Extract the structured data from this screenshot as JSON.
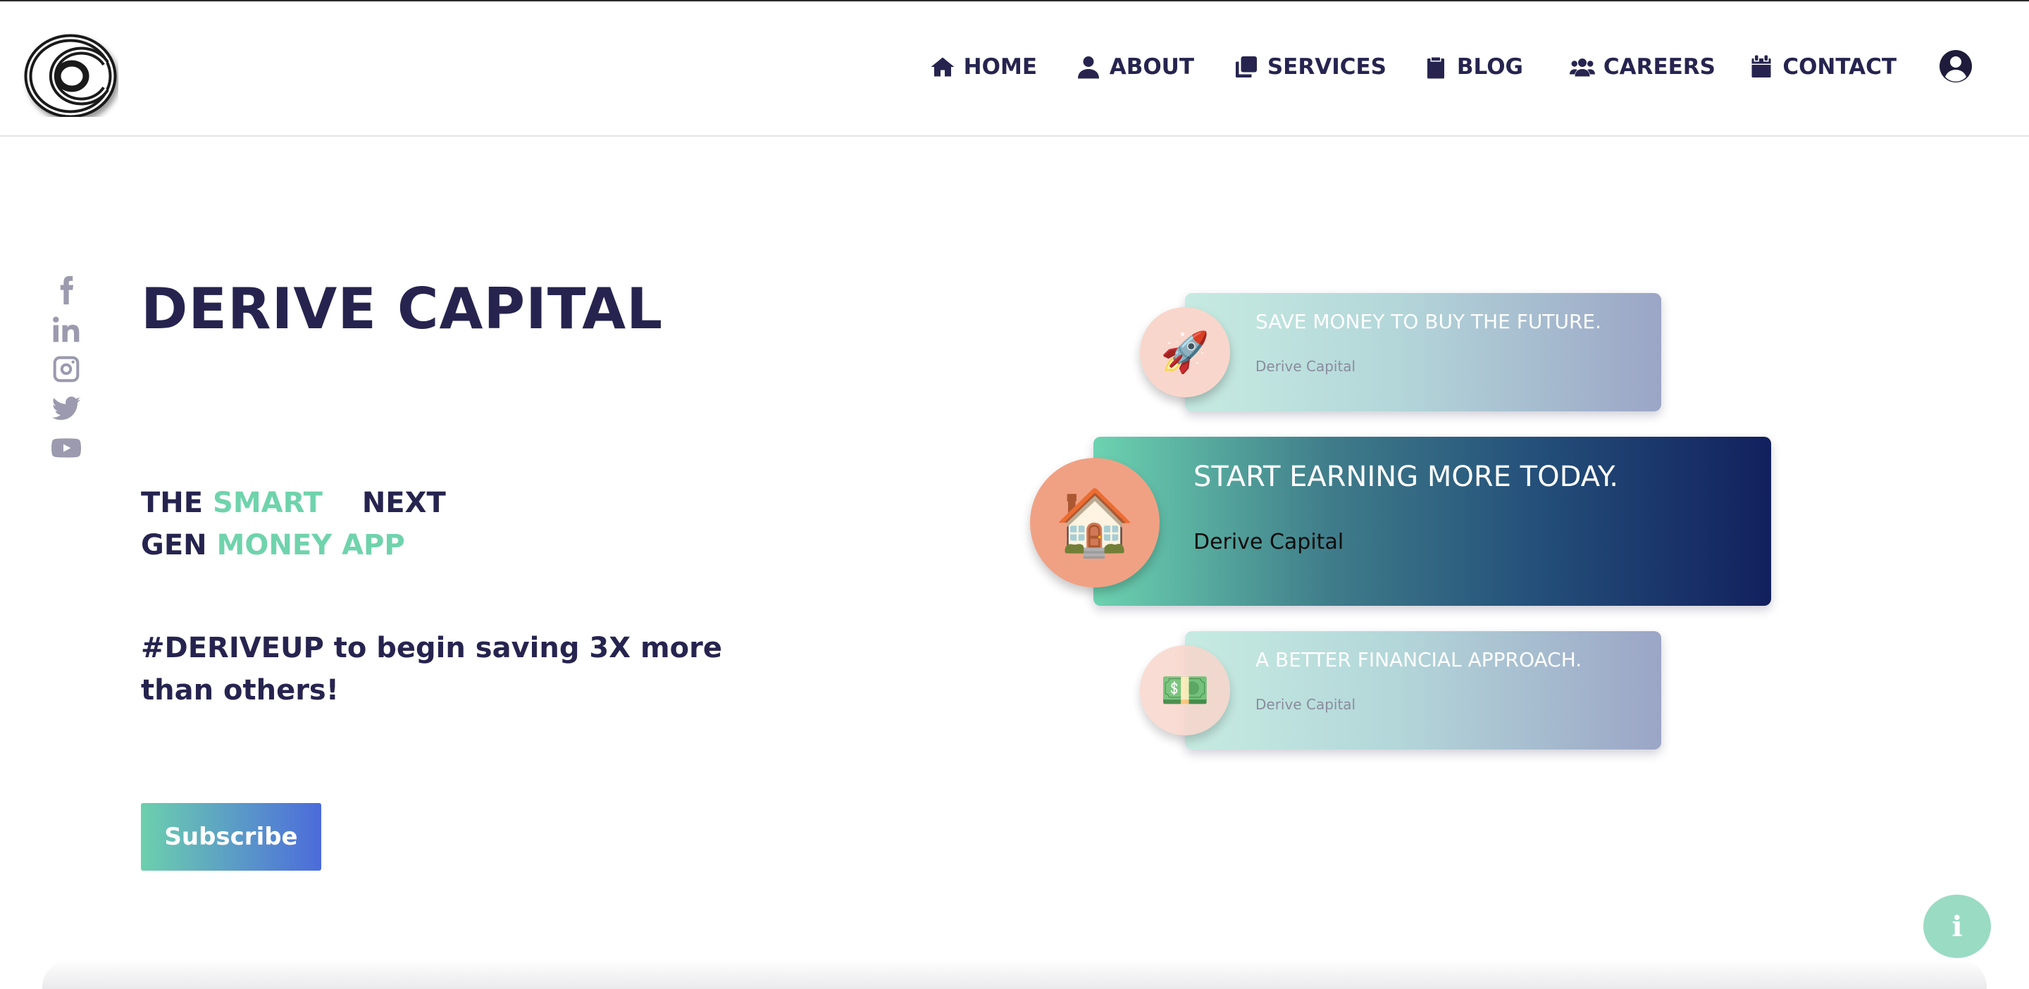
{
  "nav": {
    "items": [
      {
        "label": "HOME",
        "icon": "home-icon"
      },
      {
        "label": "ABOUT",
        "icon": "user-icon"
      },
      {
        "label": "SERVICES",
        "icon": "clone-icon"
      },
      {
        "label": "BLOG",
        "icon": "clipboard-icon"
      },
      {
        "label": "CAREERS",
        "icon": "users-icon"
      },
      {
        "label": "CONTACT",
        "icon": "calendar-icon"
      }
    ]
  },
  "social": [
    "facebook-icon",
    "linkedin-icon",
    "instagram-icon",
    "twitter-icon",
    "youtube-icon"
  ],
  "hero": {
    "title": "DERIVE CAPITAL",
    "tagline": {
      "w1": "THE",
      "w2": "SMART",
      "w3": "NEXT",
      "w4": "GEN",
      "w5": "MONEY APP"
    },
    "promo": "#DERIVEUP to begin saving 3X more than others!",
    "subscribe_label": "Subscribe"
  },
  "cards": [
    {
      "title": "SAVE MONEY TO BUY THE FUTURE.",
      "subtitle": "Derive Capital",
      "emoji": "🚀"
    },
    {
      "title": "START EARNING MORE TODAY.",
      "subtitle": "Derive Capital",
      "emoji": "🏠"
    },
    {
      "title": "A BETTER FINANCIAL APPROACH.",
      "subtitle": "Derive Capital",
      "emoji": "💵"
    }
  ],
  "info_label": "i",
  "colors": {
    "navy": "#26244f",
    "mint": "#6fd3ac",
    "circle_orange": "#f0a184",
    "circle_pale": "#f9d6cc",
    "info": "#9adbc4"
  }
}
